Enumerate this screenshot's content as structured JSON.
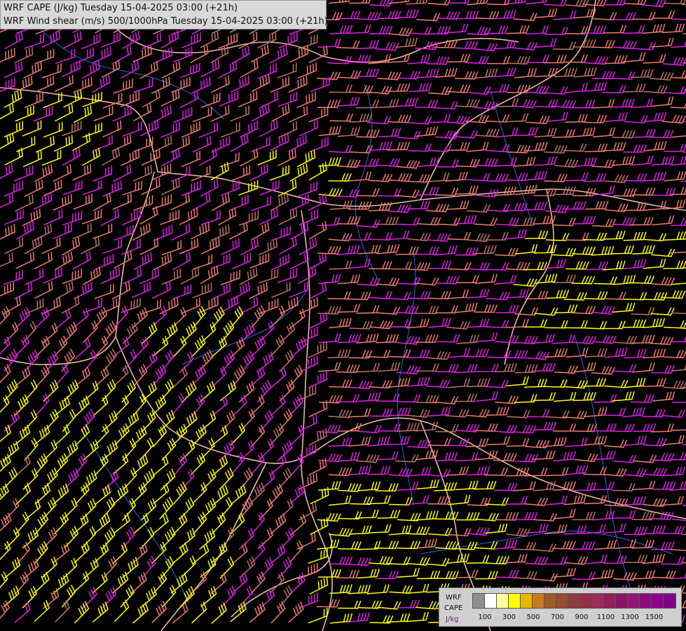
{
  "title": {
    "line1": "WRF CAPE (J/kg) Tuesday 15-04-2025 03:00 (+21h)",
    "line2": "WRF Wind shear (m/s) 500/1000hPa Tuesday 15-04-2025 03:00 (+21h)"
  },
  "legend": {
    "model": "WRF",
    "field": "CAPE",
    "unit": "J/kg",
    "colors": [
      "#8f8f8f",
      "#ffffff",
      "#ffffa0",
      "#ffff00",
      "#e6b800",
      "#c8781e",
      "#a05a28",
      "#964b32",
      "#8c3c3c",
      "#962d46",
      "#a0285a",
      "#961e5a",
      "#8c1464",
      "#961478",
      "#8c0a7d",
      "#8c008c",
      "#800088"
    ],
    "tick_labels": [
      "100",
      "300",
      "500",
      "700",
      "900",
      "1100",
      "1300",
      "1500"
    ]
  },
  "map": {
    "barb_colors": {
      "low": "#ffff00",
      "mid": "#f07a70",
      "dim": "#c07068",
      "high": "#e01ee6"
    },
    "border_color": "#e8b8a8",
    "river_color": "#2a6ad8"
  }
}
